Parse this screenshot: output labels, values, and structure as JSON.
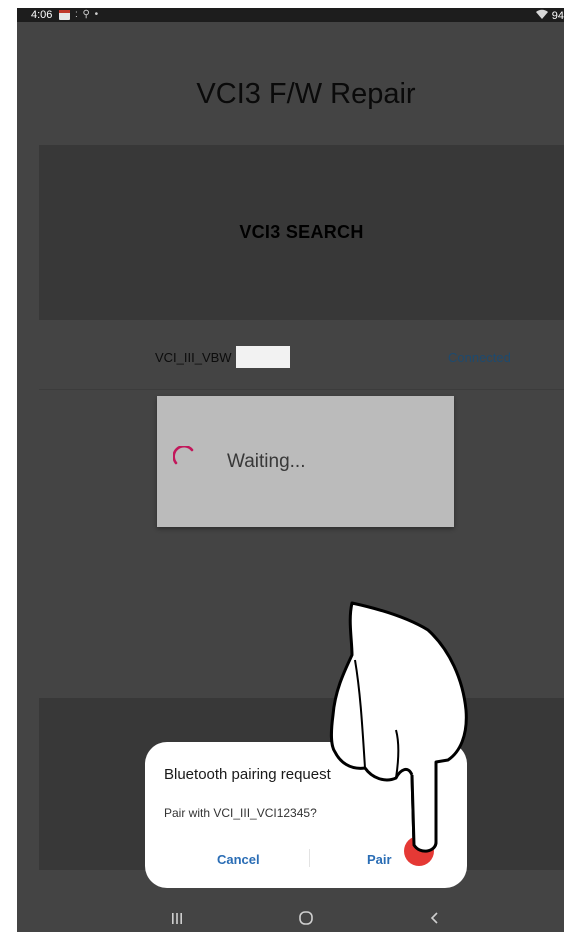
{
  "status_bar": {
    "time": "4:06",
    "calendar_day": "14",
    "notification_icons": ": ⚲ •",
    "battery": "94"
  },
  "app": {
    "title": "VCI3 F/W Repair",
    "search_button": "VCI3 SEARCH"
  },
  "device_list": [
    {
      "name": "VCI_III_VBW",
      "status": "Connected"
    }
  ],
  "waiting_dialog": {
    "message": "Waiting...",
    "spinner_color": "#c2185b"
  },
  "pairing_dialog": {
    "title": "Bluetooth pairing request",
    "message": "Pair with VCI_III_VCI12345?",
    "cancel_label": "Cancel",
    "confirm_label": "Pair"
  },
  "nav_bar": {
    "icons": [
      "recent-apps-icon",
      "home-icon",
      "back-icon"
    ]
  },
  "colors": {
    "dim_background": "#444444",
    "link_blue": "#2a6db5",
    "tap_indicator": "#e53935"
  }
}
